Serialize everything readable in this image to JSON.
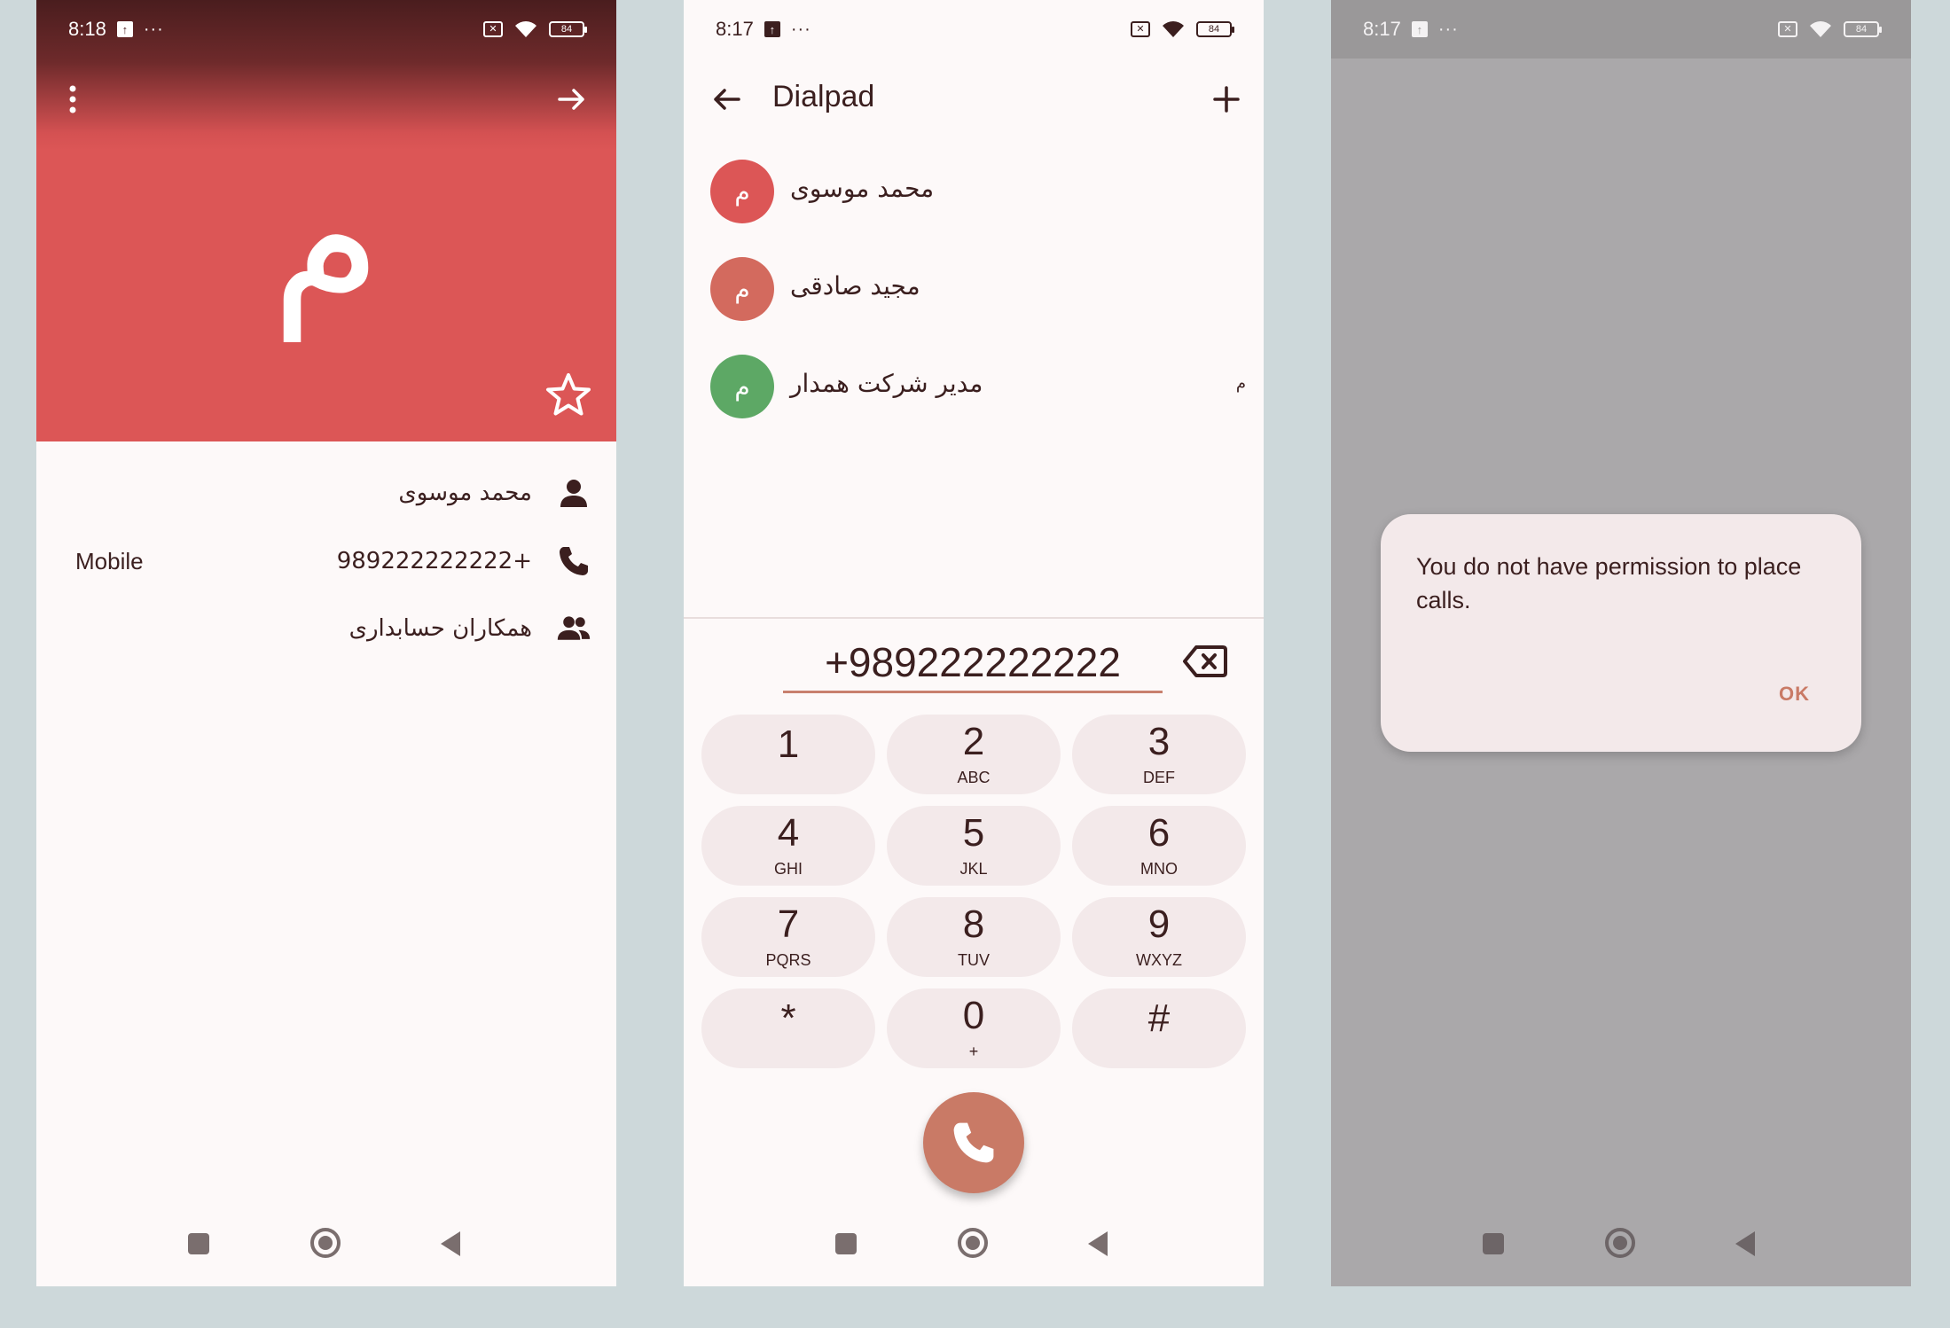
{
  "screen1": {
    "status": {
      "time": "8:18",
      "dots": "···",
      "battery": "84"
    },
    "avatar_letter": "م",
    "details": {
      "name": "محمد موسوی",
      "phone_type": "Mobile",
      "phone": "989222222222+",
      "group": "همکاران حسابداری"
    }
  },
  "screen2": {
    "status": {
      "time": "8:17",
      "dots": "···",
      "battery": "84"
    },
    "title": "Dialpad",
    "contacts": [
      {
        "initial": "م",
        "name": "محمد موسوی",
        "color": "#dc5656"
      },
      {
        "initial": "م",
        "name": "مجید صادقی",
        "color": "#d36a5e"
      },
      {
        "initial": "م",
        "name": "مدیر شرکت همدار",
        "color": "#5da865",
        "side": "م"
      }
    ],
    "dial_value": "+989222222222",
    "keys": [
      {
        "digit": "1",
        "letters": ""
      },
      {
        "digit": "2",
        "letters": "ABC"
      },
      {
        "digit": "3",
        "letters": "DEF"
      },
      {
        "digit": "4",
        "letters": "GHI"
      },
      {
        "digit": "5",
        "letters": "JKL"
      },
      {
        "digit": "6",
        "letters": "MNO"
      },
      {
        "digit": "7",
        "letters": "PQRS"
      },
      {
        "digit": "8",
        "letters": "TUV"
      },
      {
        "digit": "9",
        "letters": "WXYZ"
      },
      {
        "digit": "*",
        "letters": ""
      },
      {
        "digit": "0",
        "letters": "+"
      },
      {
        "digit": "#",
        "letters": ""
      }
    ]
  },
  "screen3": {
    "status": {
      "time": "8:17",
      "dots": "···",
      "battery": "84"
    },
    "dialog": {
      "message": "You do not have permission to place calls.",
      "ok_label": "OK"
    }
  },
  "colors": {
    "hero": "#dc5656",
    "accent": "#c97a66",
    "key_bg": "#f3e9ea",
    "text": "#3b1f1f"
  }
}
